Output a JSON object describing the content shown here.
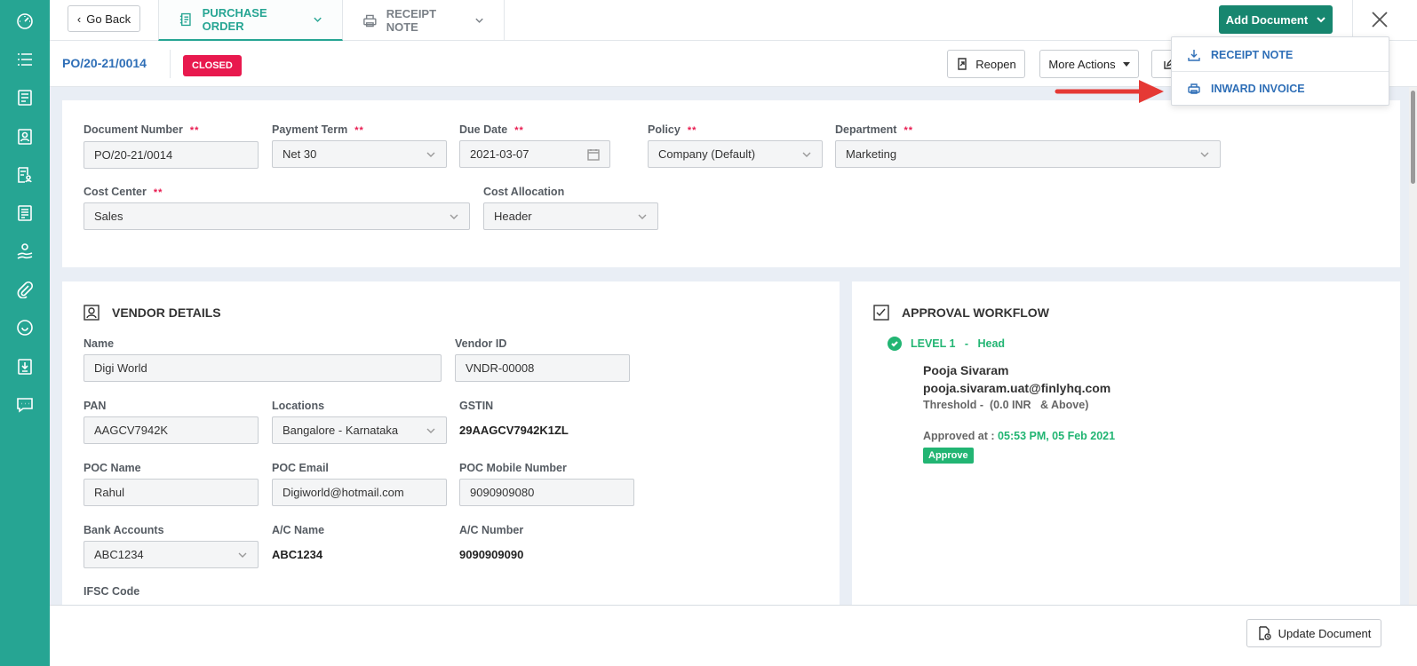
{
  "header": {
    "go_back": "Go Back",
    "tabs": [
      {
        "label": "PURCHASE ORDER",
        "icon": "purchase-order-icon",
        "active": true
      },
      {
        "label": "RECEIPT NOTE",
        "icon": "printer-icon",
        "active": false
      }
    ],
    "add_document": "Add Document"
  },
  "subheader": {
    "document_id": "PO/20-21/0014",
    "status": "CLOSED",
    "reopen": "Reopen",
    "more_actions": "More Actions"
  },
  "add_document_menu": {
    "items": [
      {
        "label": "RECEIPT NOTE",
        "icon": "download-icon"
      },
      {
        "label": "INWARD INVOICE",
        "icon": "printer-icon"
      }
    ]
  },
  "document_form": {
    "document_number": {
      "label": "Document Number",
      "value": "PO/20-21/0014",
      "required": "**"
    },
    "payment_term": {
      "label": "Payment Term",
      "value": "Net 30",
      "required": "**"
    },
    "due_date": {
      "label": "Due Date",
      "value": "2021-03-07",
      "required": "**"
    },
    "policy": {
      "label": "Policy",
      "value": "Company (Default)",
      "required": "**"
    },
    "department": {
      "label": "Department",
      "value": "Marketing",
      "required": "**"
    },
    "cost_center": {
      "label": "Cost Center",
      "value": "Sales",
      "required": "**"
    },
    "cost_allocation": {
      "label": "Cost Allocation",
      "value": "Header"
    }
  },
  "vendor": {
    "title": "VENDOR DETAILS",
    "name": {
      "label": "Name",
      "value": "Digi World"
    },
    "vendor_id": {
      "label": "Vendor ID",
      "value": "VNDR-00008"
    },
    "pan": {
      "label": "PAN",
      "value": "AAGCV7942K"
    },
    "locations": {
      "label": "Locations",
      "value": "Bangalore - Karnataka"
    },
    "gstin": {
      "label": "GSTIN",
      "value": "29AAGCV7942K1ZL"
    },
    "poc_name": {
      "label": "POC Name",
      "value": "Rahul"
    },
    "poc_email": {
      "label": "POC Email",
      "value": "Digiworld@hotmail.com"
    },
    "poc_mobile": {
      "label": "POC Mobile Number",
      "value": "9090909080"
    },
    "bank_accounts": {
      "label": "Bank Accounts",
      "value": "ABC1234"
    },
    "ac_name": {
      "label": "A/C Name",
      "value": "ABC1234"
    },
    "ac_number": {
      "label": "A/C Number",
      "value": "9090909090"
    },
    "ifsc": {
      "label": "IFSC Code"
    }
  },
  "approval": {
    "title": "APPROVAL WORKFLOW",
    "level": "LEVEL 1   -   Head",
    "approver_name": "Pooja Sivaram",
    "approver_email": "pooja.sivaram.uat@finlyhq.com",
    "threshold": "Threshold -  (0.0 INR   & Above)",
    "approved_at_label": "Approved at : ",
    "approved_at_value": "05:53 PM, 05 Feb 2021",
    "badge": "Approve"
  },
  "footer": {
    "update_document": "Update Document"
  },
  "colors": {
    "sidebar": "#26a593",
    "primary_button": "#17866f",
    "link_blue": "#2f6fb7",
    "closed_badge": "#e8194e",
    "success": "#22b573",
    "annotation_arrow": "#e53935"
  }
}
